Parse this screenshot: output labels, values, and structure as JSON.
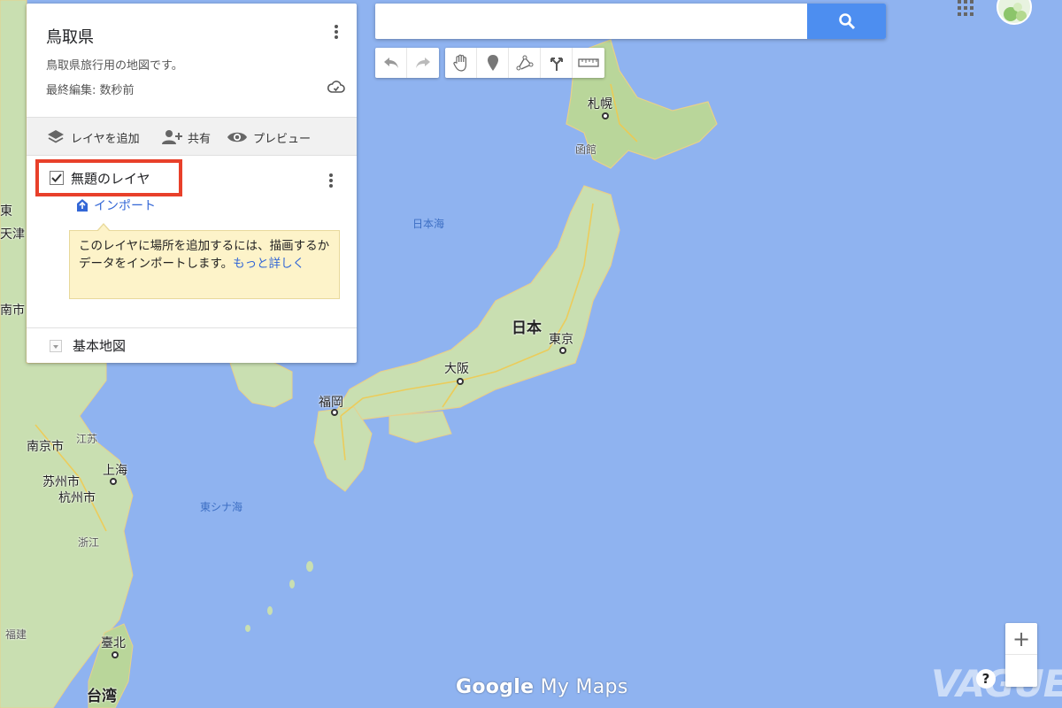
{
  "map": {
    "labels": {
      "sapporo": "札幌",
      "hakodate": "函館",
      "nihonkai": "日本海",
      "nihon": "日本",
      "tokyo": "東京",
      "osaka": "大阪",
      "fukuoka": "福岡",
      "higashishinakai": "東シナ海",
      "nanjing": "南京市",
      "jiangsu": "江苏",
      "shanghai": "上海",
      "suzhou": "苏州市",
      "hangzhou": "杭州市",
      "zhejiang": "浙江",
      "taibei": "臺北",
      "taiwan": "台湾",
      "taiwan_small": "福建",
      "tianjin": "天津",
      "east_edge": "東",
      "jinan": "南市"
    }
  },
  "panel": {
    "title": "鳥取県",
    "description": "鳥取県旅行用の地図です。",
    "last_edited": "最終編集: 数秒前",
    "actions": {
      "add_layer": "レイヤを追加",
      "share": "共有",
      "preview": "プレビュー"
    },
    "layer": {
      "title": "無題のレイヤ",
      "checked": true,
      "import": "インポート"
    },
    "tooltip": {
      "text": "このレイヤに場所を追加するには、描画するかデータをインポートします。",
      "more": "もっと詳しく"
    },
    "basemap": "基本地図"
  },
  "search": {
    "placeholder": "",
    "value": ""
  },
  "toolbar": {
    "icons": [
      "undo-icon",
      "redo-icon",
      "hand-icon",
      "marker-icon",
      "draw-line-icon",
      "directions-icon",
      "ruler-icon"
    ]
  },
  "footer": {
    "logo_google": "Google",
    "logo_mymaps": "My Maps",
    "zoom_in": "+",
    "help": "?",
    "watermark": "VAGUE"
  },
  "colors": {
    "sea": "#8fb3f0",
    "land": "#c9dfb1",
    "accent": "#4d8ef0",
    "highlight": "#e8402a",
    "tooltip_bg": "#fdf3c9"
  }
}
